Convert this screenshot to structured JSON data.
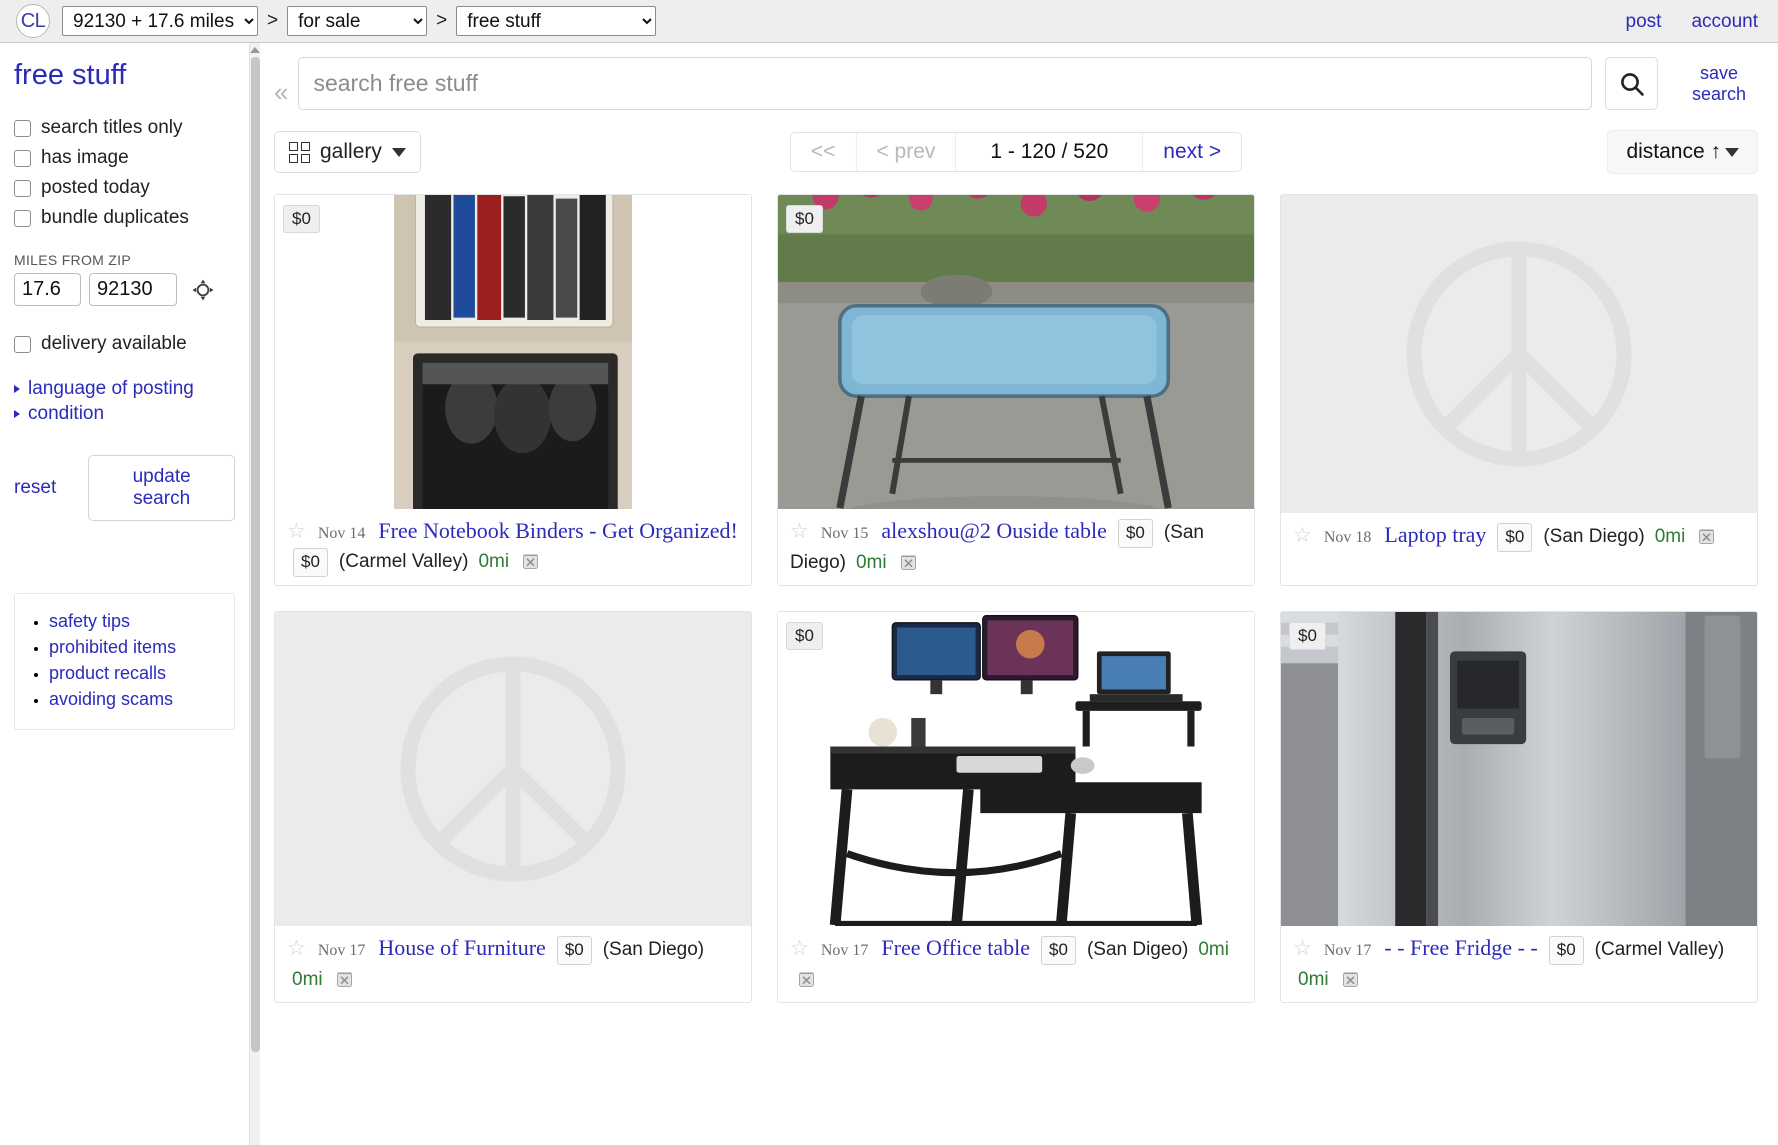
{
  "topbar": {
    "logo": "CL",
    "breadcrumbs": [
      {
        "name": "location-select",
        "value": "92130 + 17.6 miles"
      },
      {
        "name": "category-select",
        "value": "for sale"
      },
      {
        "name": "subcategory-select",
        "value": "free stuff"
      }
    ],
    "separator": ">",
    "post_label": "post",
    "account_label": "account"
  },
  "sidebar": {
    "title": "free stuff",
    "checkboxes": [
      {
        "label": "search titles only",
        "checked": false
      },
      {
        "label": "has image",
        "checked": false
      },
      {
        "label": "posted today",
        "checked": false
      },
      {
        "label": "bundle duplicates",
        "checked": false
      }
    ],
    "miles_from_zip_label": "MILES FROM ZIP",
    "miles_value": "17.6",
    "zip_value": "92130",
    "delivery": {
      "label": "delivery available",
      "checked": false
    },
    "expanders": [
      {
        "label": "language of posting"
      },
      {
        "label": "condition"
      }
    ],
    "reset_label": "reset",
    "update_search_label": "update search",
    "safety_links": [
      "safety tips",
      "prohibited items",
      "product recalls",
      "avoiding scams"
    ]
  },
  "search": {
    "placeholder": "search free stuff",
    "value": "",
    "save_search_line1": "save",
    "save_search_line2": "search"
  },
  "toolbar": {
    "view_label": "gallery",
    "pager": {
      "first_label": "<<",
      "prev_label": "< prev",
      "range_label": "1 - 120 / 520",
      "next_label": "next >"
    },
    "sort_label": "distance ↑"
  },
  "colors": {
    "link": "#2b2bbb",
    "distance": "#2f7a35",
    "topbar_bg": "#eeeeee"
  },
  "listings": [
    {
      "price_badge": "$0",
      "date": "Nov 14",
      "title": "Free Notebook Binders - Get Organized!",
      "price": "$0",
      "hood": "(Carmel Valley)",
      "distance": "0mi",
      "image": "binders"
    },
    {
      "price_badge": "$0",
      "date": "Nov 15",
      "title": "alexshou@2 Ouside table",
      "price": "$0",
      "hood": "(San Diego)",
      "distance": "0mi",
      "image": "patio-table"
    },
    {
      "price_badge": "",
      "date": "Nov 18",
      "title": "Laptop tray",
      "price": "$0",
      "hood": "(San Diego)",
      "distance": "0mi",
      "image": "no-image"
    },
    {
      "price_badge": "",
      "date": "Nov 17",
      "title": "House of Furniture",
      "price": "$0",
      "hood": "(San Diego)",
      "distance": "0mi",
      "image": "no-image"
    },
    {
      "price_badge": "$0",
      "date": "Nov 17",
      "title": "Free Office table",
      "price": "$0",
      "hood": "(San Digeo)",
      "distance": "0mi",
      "image": "desk"
    },
    {
      "price_badge": "$0",
      "date": "Nov 17",
      "title": "- - Free Fridge - -",
      "price": "$0",
      "hood": "(Carmel Valley)",
      "distance": "0mi",
      "image": "fridge"
    }
  ]
}
